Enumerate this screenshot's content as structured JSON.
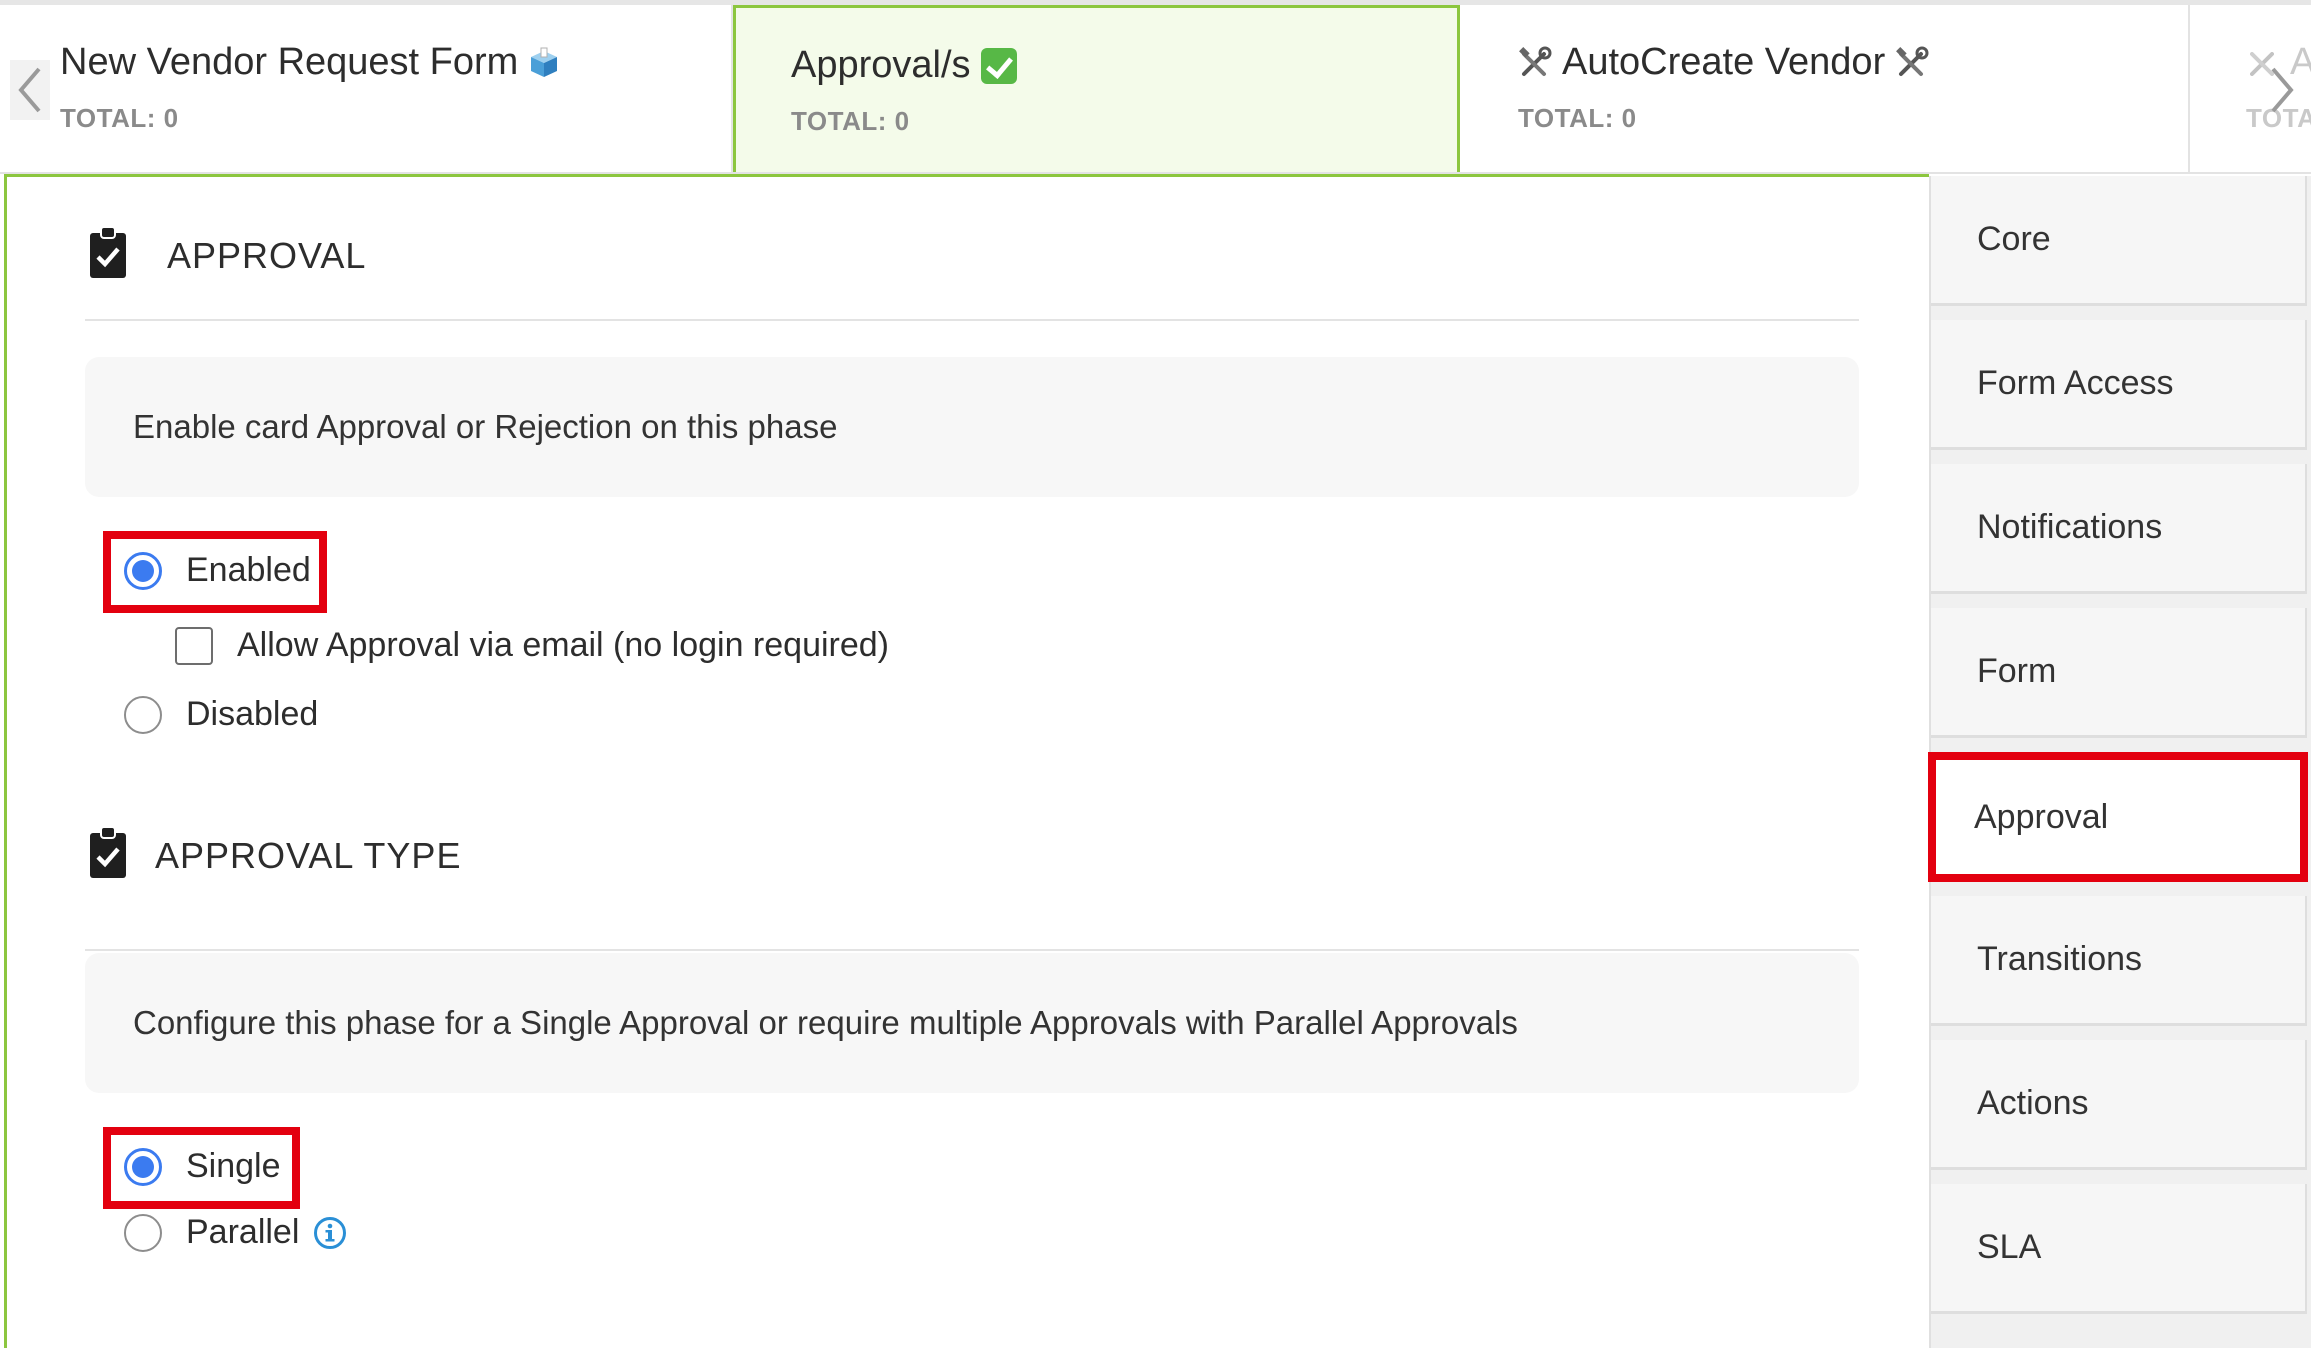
{
  "tabs": [
    {
      "title": "New Vendor Request Form",
      "total": "TOTAL: 0",
      "icon": "ballot-box-icon"
    },
    {
      "title": "Approval/s",
      "total": "TOTAL: 0",
      "icon": "green-check-icon",
      "active": true
    },
    {
      "title": "AutoCreate Vendor",
      "total": "TOTAL: 0",
      "icon": "tools-icon"
    },
    {
      "title": "A",
      "total": "TOTA",
      "icon": "tools-icon"
    }
  ],
  "approval": {
    "heading": "APPROVAL",
    "description": "Enable card Approval or Rejection on this phase",
    "enabled_label": "Enabled",
    "email_label": "Allow Approval via email (no login required)",
    "disabled_label": "Disabled",
    "selected": "enabled"
  },
  "approval_type": {
    "heading": "APPROVAL TYPE",
    "description": "Configure this phase for a Single Approval or require multiple Approvals with Parallel Approvals",
    "single_label": "Single",
    "parallel_label": "Parallel",
    "selected": "single"
  },
  "sidebar": {
    "items": [
      {
        "label": "Core"
      },
      {
        "label": "Form Access"
      },
      {
        "label": "Notifications"
      },
      {
        "label": "Form"
      },
      {
        "label": "Approval",
        "active": true
      },
      {
        "label": "Transitions"
      },
      {
        "label": "Actions"
      },
      {
        "label": "SLA"
      }
    ]
  },
  "colors": {
    "accent_green": "#8cc63f",
    "active_tab_bg": "#f4fbea",
    "radio_blue": "#3b7bf0",
    "highlight_red": "#e3000f"
  }
}
